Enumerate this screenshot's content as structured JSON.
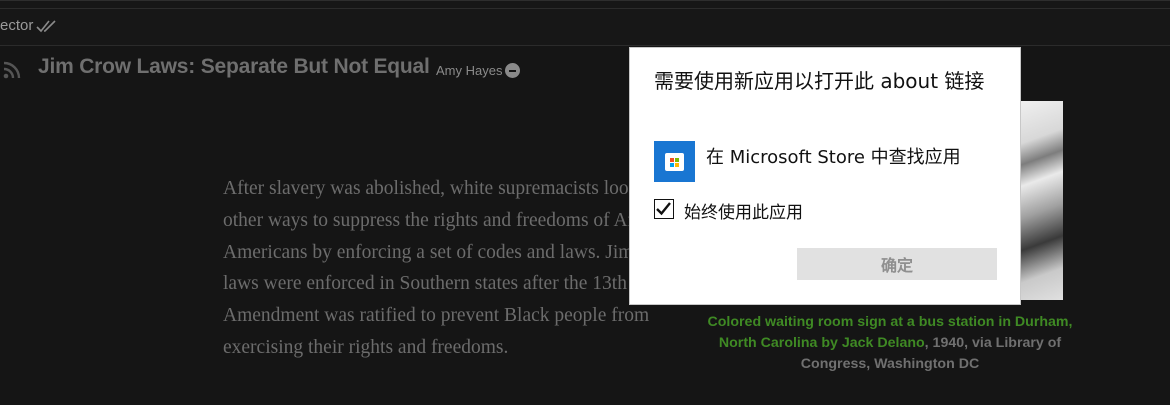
{
  "topbar": {
    "collector_label": "ector"
  },
  "article": {
    "title": "Jim Crow Laws: Separate But Not Equal",
    "author": "Amy Hayes",
    "paragraph": "After slavery was abolished, white supremacists looked for other ways to suppress the rights and freedoms of African Americans by enforcing a set of codes and laws. Jim Crow laws were enforced in Southern states after the 13th Amendment was ratified to prevent Black people from exercising their rights and freedoms."
  },
  "caption": {
    "link_text": "Colored waiting room sign at a bus station in Durham, North Carolina by Jack Delano",
    "rest_text": ", 1940, via Library of Congress, Washington DC",
    "link_color": "#3f8a24"
  },
  "dialog": {
    "title": "需要使用新应用以打开此 about 链接",
    "store_option": "在 Microsoft Store 中查找应用",
    "always_use_label": "始终使用此应用",
    "always_use_checked": true,
    "ok_label": "确定",
    "accent_color": "#1976d2"
  },
  "icons": {
    "rss": "rss-icon",
    "double_check": "double-check-icon",
    "minus": "minus-circle-icon",
    "store": "microsoft-store-icon",
    "checkmark": "checkmark-icon"
  }
}
